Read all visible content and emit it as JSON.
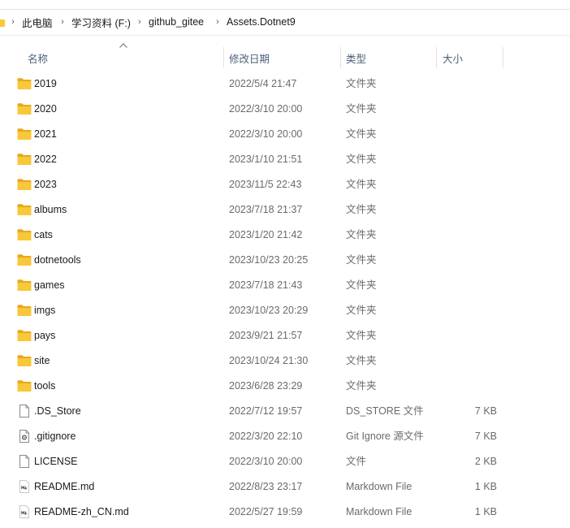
{
  "breadcrumb": {
    "items": [
      "此电脑",
      "学习资料 (F:)",
      "github_gitee",
      "Assets.Dotnet9"
    ]
  },
  "columns": {
    "name": "名称",
    "modified": "修改日期",
    "type": "类型",
    "size": "大小"
  },
  "sort": {
    "column": "name",
    "direction": "ascending"
  },
  "colors": {
    "folder": "#F8C73A",
    "folder_dark": "#E8A81A",
    "header_text": "#4C607A"
  },
  "files": [
    {
      "name": "2019",
      "modified": "2022/5/4 21:47",
      "type": "文件夹",
      "size": "",
      "icon": "folder-icon"
    },
    {
      "name": "2020",
      "modified": "2022/3/10 20:00",
      "type": "文件夹",
      "size": "",
      "icon": "folder-icon"
    },
    {
      "name": "2021",
      "modified": "2022/3/10 20:00",
      "type": "文件夹",
      "size": "",
      "icon": "folder-icon"
    },
    {
      "name": "2022",
      "modified": "2023/1/10 21:51",
      "type": "文件夹",
      "size": "",
      "icon": "folder-icon"
    },
    {
      "name": "2023",
      "modified": "2023/11/5 22:43",
      "type": "文件夹",
      "size": "",
      "icon": "folder-icon"
    },
    {
      "name": "albums",
      "modified": "2023/7/18 21:37",
      "type": "文件夹",
      "size": "",
      "icon": "folder-icon"
    },
    {
      "name": "cats",
      "modified": "2023/1/20 21:42",
      "type": "文件夹",
      "size": "",
      "icon": "folder-icon"
    },
    {
      "name": "dotnetools",
      "modified": "2023/10/23 20:25",
      "type": "文件夹",
      "size": "",
      "icon": "folder-icon"
    },
    {
      "name": "games",
      "modified": "2023/7/18 21:43",
      "type": "文件夹",
      "size": "",
      "icon": "folder-icon"
    },
    {
      "name": "imgs",
      "modified": "2023/10/23 20:29",
      "type": "文件夹",
      "size": "",
      "icon": "folder-icon"
    },
    {
      "name": "pays",
      "modified": "2023/9/21 21:57",
      "type": "文件夹",
      "size": "",
      "icon": "folder-icon"
    },
    {
      "name": "site",
      "modified": "2023/10/24 21:30",
      "type": "文件夹",
      "size": "",
      "icon": "folder-icon"
    },
    {
      "name": "tools",
      "modified": "2023/6/28 23:29",
      "type": "文件夹",
      "size": "",
      "icon": "folder-icon"
    },
    {
      "name": ".DS_Store",
      "modified": "2022/7/12 19:57",
      "type": "DS_STORE 文件",
      "size": "7 KB",
      "icon": "blank-file-icon"
    },
    {
      "name": ".gitignore",
      "modified": "2022/3/20 22:10",
      "type": "Git Ignore 源文件",
      "size": "7 KB",
      "icon": "settings-file-icon"
    },
    {
      "name": "LICENSE",
      "modified": "2022/3/10 20:00",
      "type": "文件",
      "size": "2 KB",
      "icon": "blank-file-icon"
    },
    {
      "name": "README.md",
      "modified": "2022/8/23 23:17",
      "type": "Markdown File",
      "size": "1 KB",
      "icon": "markdown-file-icon"
    },
    {
      "name": "README-zh_CN.md",
      "modified": "2022/5/27 19:59",
      "type": "Markdown File",
      "size": "1 KB",
      "icon": "markdown-file-icon"
    }
  ]
}
